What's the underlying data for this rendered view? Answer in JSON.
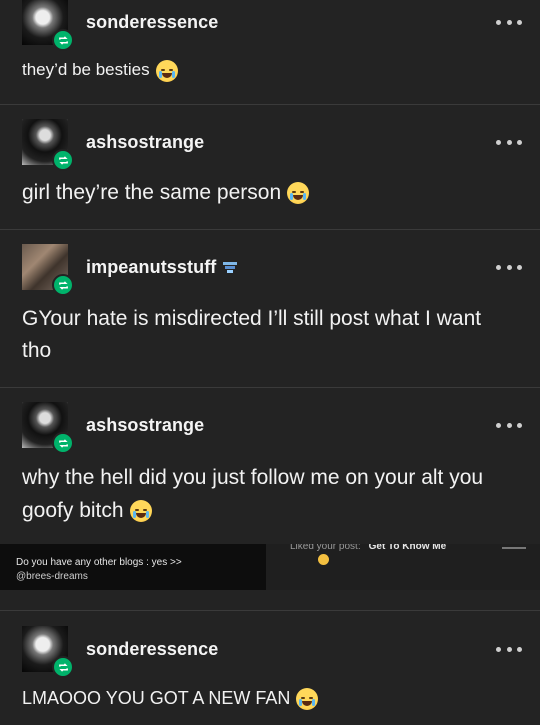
{
  "posts": [
    {
      "username": "sonderessence",
      "text": "they’d be besties",
      "emoji": "laughing-tears-emoji"
    },
    {
      "username": "ashsostrange",
      "text": "girl they’re the same person",
      "emoji": "crying-emoji"
    },
    {
      "username": "impeanutsstuff",
      "text": "GYour hate is misdirected I’ll still post what I want tho",
      "emoji": ""
    },
    {
      "username": "ashsostrange",
      "text": "why the hell did you just follow me on your alt you goofy bitch",
      "emoji": "crying-emoji"
    },
    {
      "username": "sonderessence",
      "text": "LMAOOO YOU GOT A NEW FAN",
      "emoji": "crying-emoji"
    }
  ],
  "embedded": {
    "question": "Do you have any other blogs : yes >>",
    "handle": "@brees-dreams",
    "liked_text": "Liked your post:",
    "liked_title": "Get To Know Me"
  }
}
